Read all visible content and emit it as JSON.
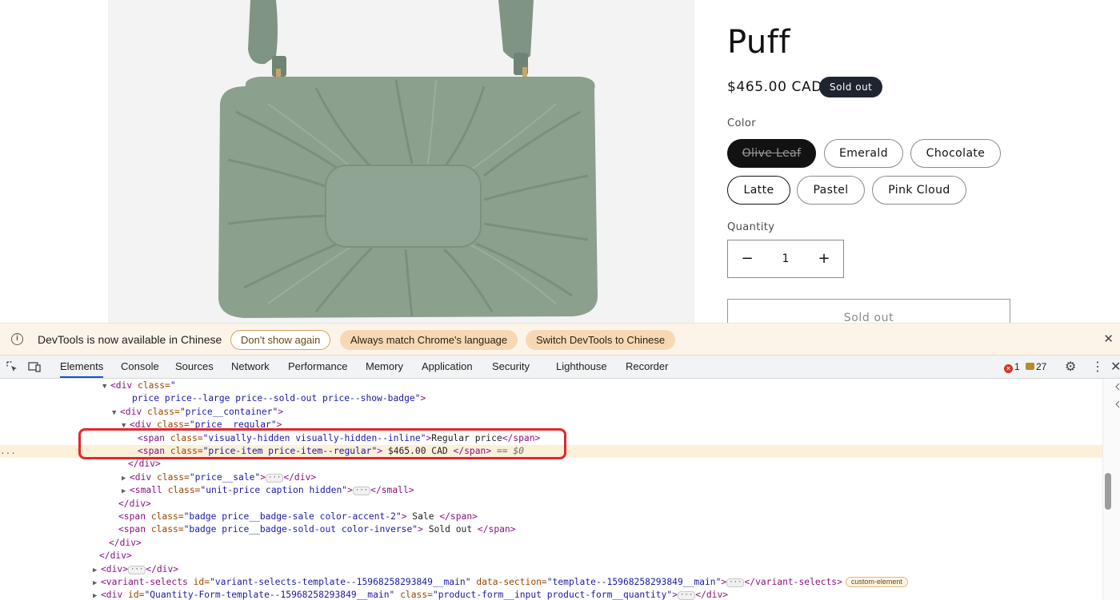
{
  "product": {
    "title": "Puff",
    "price": "$465.00 CAD",
    "badge": "Sold out",
    "color_label": "Color",
    "colors": [
      "Olive Leaf",
      "Emerald",
      "Chocolate",
      "Latte",
      "Pastel",
      "Pink Cloud"
    ],
    "selected_color": "Olive Leaf",
    "quantity_label": "Quantity",
    "quantity_minus": "−",
    "quantity_value": "1",
    "quantity_plus": "+",
    "soldout_button": "Sold out"
  },
  "devtools": {
    "infobar": {
      "icon": "info-icon",
      "message": "DevTools is now available in Chinese",
      "dont_show": "Don't show again",
      "match_lang": "Always match Chrome's language",
      "switch": "Switch DevTools to Chinese",
      "close": "✕"
    },
    "tabs": [
      "Elements",
      "Console",
      "Sources",
      "Network",
      "Performance",
      "Memory",
      "Application",
      "Security",
      "Lighthouse",
      "Recorder"
    ],
    "active_tab": "Elements",
    "error_count": "1",
    "message_count": "27",
    "gutter_dots": "...",
    "dom": {
      "l1_tag_open": "<div",
      "l1_attr": " class=",
      "l1_val": "\"",
      "l2_val": "price price--large price--sold-out price--show-badge\"",
      "l2_close": ">",
      "l3_tag": "<div",
      "l3_attr": " class=",
      "l3_val": "\"price__container\"",
      "l3_close": ">",
      "l4_tag": "<div",
      "l4_attr": " class=",
      "l4_val": "\"price__regular\"",
      "l4_close": ">",
      "l5_tag": "<span",
      "l5_attr": " class=",
      "l5_val": "\"visually-hidden visually-hidden--inline\"",
      "l5_mid": ">",
      "l5_text": "Regular price",
      "l5_end": "</span>",
      "l6_tag": "<span",
      "l6_attr": " class=",
      "l6_val": "\"price-item price-item--regular\"",
      "l6_mid": ">",
      "l6_text": " $465.00 CAD ",
      "l6_end": "</span>",
      "l6_eq": " == $0",
      "l7_end": "</div>",
      "l8_tag": "<div",
      "l8_attr": " class=",
      "l8_val": "\"price__sale\"",
      "l8_mid": ">",
      "l8_ellipsis": "···",
      "l8_end": "</div>",
      "l9_tag": "<small",
      "l9_attr": " class=",
      "l9_val": "\"unit-price caption hidden\"",
      "l9_mid": ">",
      "l9_ellipsis": "···",
      "l9_end": "</small>",
      "l10_end": "</div>",
      "l11_tag": "<span",
      "l11_attr": " class=",
      "l11_val": "\"badge price__badge-sale color-accent-2\"",
      "l11_mid": ">",
      "l11_text": " Sale ",
      "l11_end": "</span>",
      "l12_tag": "<span",
      "l12_attr": " class=",
      "l12_val": "\"badge price__badge-sold-out color-inverse\"",
      "l12_mid": ">",
      "l12_text": " Sold out ",
      "l12_end": "</span>",
      "l13_end": "</div>",
      "l14_end": "</div>",
      "l15_tag": "<div>",
      "l15_ellipsis": "···",
      "l15_end": "</div>",
      "l16_tag": "<variant-selects",
      "l16_attr1": " id=",
      "l16_val1": "\"variant-selects-template--15968258293849__main\"",
      "l16_attr2": " data-section=",
      "l16_val2": "\"template--15968258293849__main\"",
      "l16_mid": ">",
      "l16_ellipsis": "···",
      "l16_end": "</variant-selects>",
      "l16_badge": "custom-element",
      "l17_tag": "<div",
      "l17_attr1": " id=",
      "l17_val1": "\"Quantity-Form-template--15968258293849__main\"",
      "l17_attr2": " class=",
      "l17_val2": "\"product-form__input product-form__quantity\"",
      "l17_mid": ">",
      "l17_ellipsis": "···",
      "l17_end": "</div>"
    }
  }
}
